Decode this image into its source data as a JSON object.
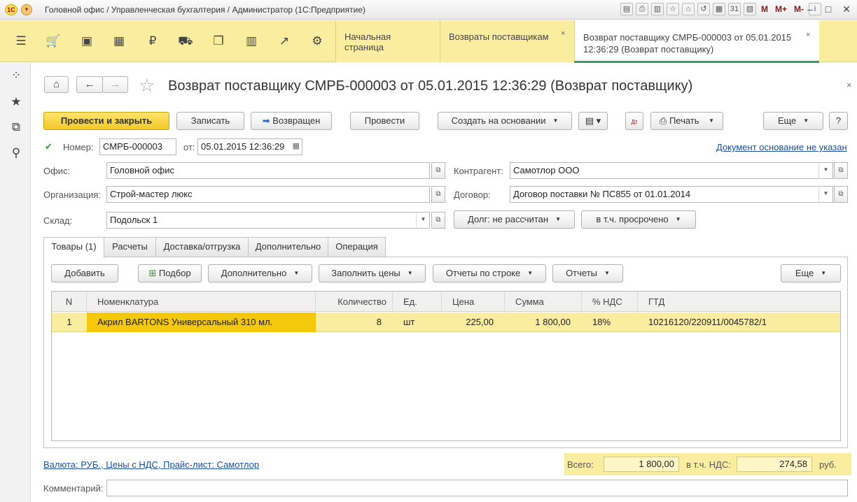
{
  "window": {
    "title": "Головной офис / Управленческая бухгалтерия / Администратор  (1С:Предприятие)",
    "logo_text": "1С",
    "toolbar_labels": [
      "M",
      "M+",
      "M-"
    ]
  },
  "sections": {
    "icons": [
      "menu-icon",
      "cart-icon",
      "bag-icon",
      "grid-icon",
      "ruble-icon",
      "truck-icon",
      "documents-icon",
      "bar-chart-icon",
      "trend-icon",
      "gear-icon"
    ]
  },
  "open_tabs": [
    {
      "label": "Начальная страница"
    },
    {
      "label": "Возвраты поставщикам"
    },
    {
      "label_line1": "Возврат поставщику СМРБ-000003 от 05.01.2015",
      "label_line2": "12:36:29 (Возврат поставщику)"
    }
  ],
  "document": {
    "title": "Возврат поставщику СМРБ-000003 от 05.01.2015 12:36:29 (Возврат поставщику)"
  },
  "commands": {
    "post_close": "Провести и закрыть",
    "save": "Записать",
    "returned": "Возвращен",
    "post": "Провести",
    "create_based": "Создать на основании",
    "print": "Печать",
    "more": "Еще",
    "help": "?"
  },
  "fields": {
    "number_label": "Номер:",
    "number": "СМРБ-000003",
    "date_label": "от:",
    "date": "05.01.2015 12:36:29",
    "base_doc_link": "Документ основание не указан",
    "office_label": "Офис:",
    "office": "Головной офис",
    "org_label": "Организация:",
    "org": "Строй-мастер люкс",
    "warehouse_label": "Склад:",
    "warehouse": "Подольск 1",
    "contractor_label": "Контрагент:",
    "contractor": "Самотлор ООО",
    "contract_label": "Договор:",
    "contract": "Договор поставки № ПС855 от 01.01.2014",
    "debt_button": "Долг: не рассчитан",
    "overdue_button": "в т.ч. просрочено"
  },
  "tabs": [
    {
      "label": "Товары (1)"
    },
    {
      "label": "Расчеты"
    },
    {
      "label": "Доставка/отгрузка"
    },
    {
      "label": "Дополнительно"
    },
    {
      "label": "Операция"
    }
  ],
  "table_toolbar": {
    "add": "Добавить",
    "pick": "Подбор",
    "extra": "Дополнительно",
    "fill_prices": "Заполнить цены",
    "row_reports": "Отчеты по строке",
    "reports": "Отчеты",
    "more": "Еще"
  },
  "table": {
    "columns": [
      "N",
      "Номенклатура",
      "Количество",
      "Ед.",
      "Цена",
      "Сумма",
      "% НДС",
      "ГТД"
    ],
    "rows": [
      {
        "n": "1",
        "item": "Акрил BARTONS Универсальный 310 мл.",
        "qty": "8",
        "unit": "шт",
        "price": "225,00",
        "sum": "1 800,00",
        "vat": "18%",
        "gtd": "10216120/220911/0045782/1"
      }
    ]
  },
  "footer": {
    "currency_link": "Валюта: РУБ., Цены с НДС, Прайс-лист: Самотлор",
    "total_label": "Всего:",
    "total": "1 800,00",
    "vat_label": "в т.ч. НДС:",
    "vat": "274,58",
    "currency": "руб.",
    "comment_label": "Комментарий:",
    "comment": ""
  }
}
